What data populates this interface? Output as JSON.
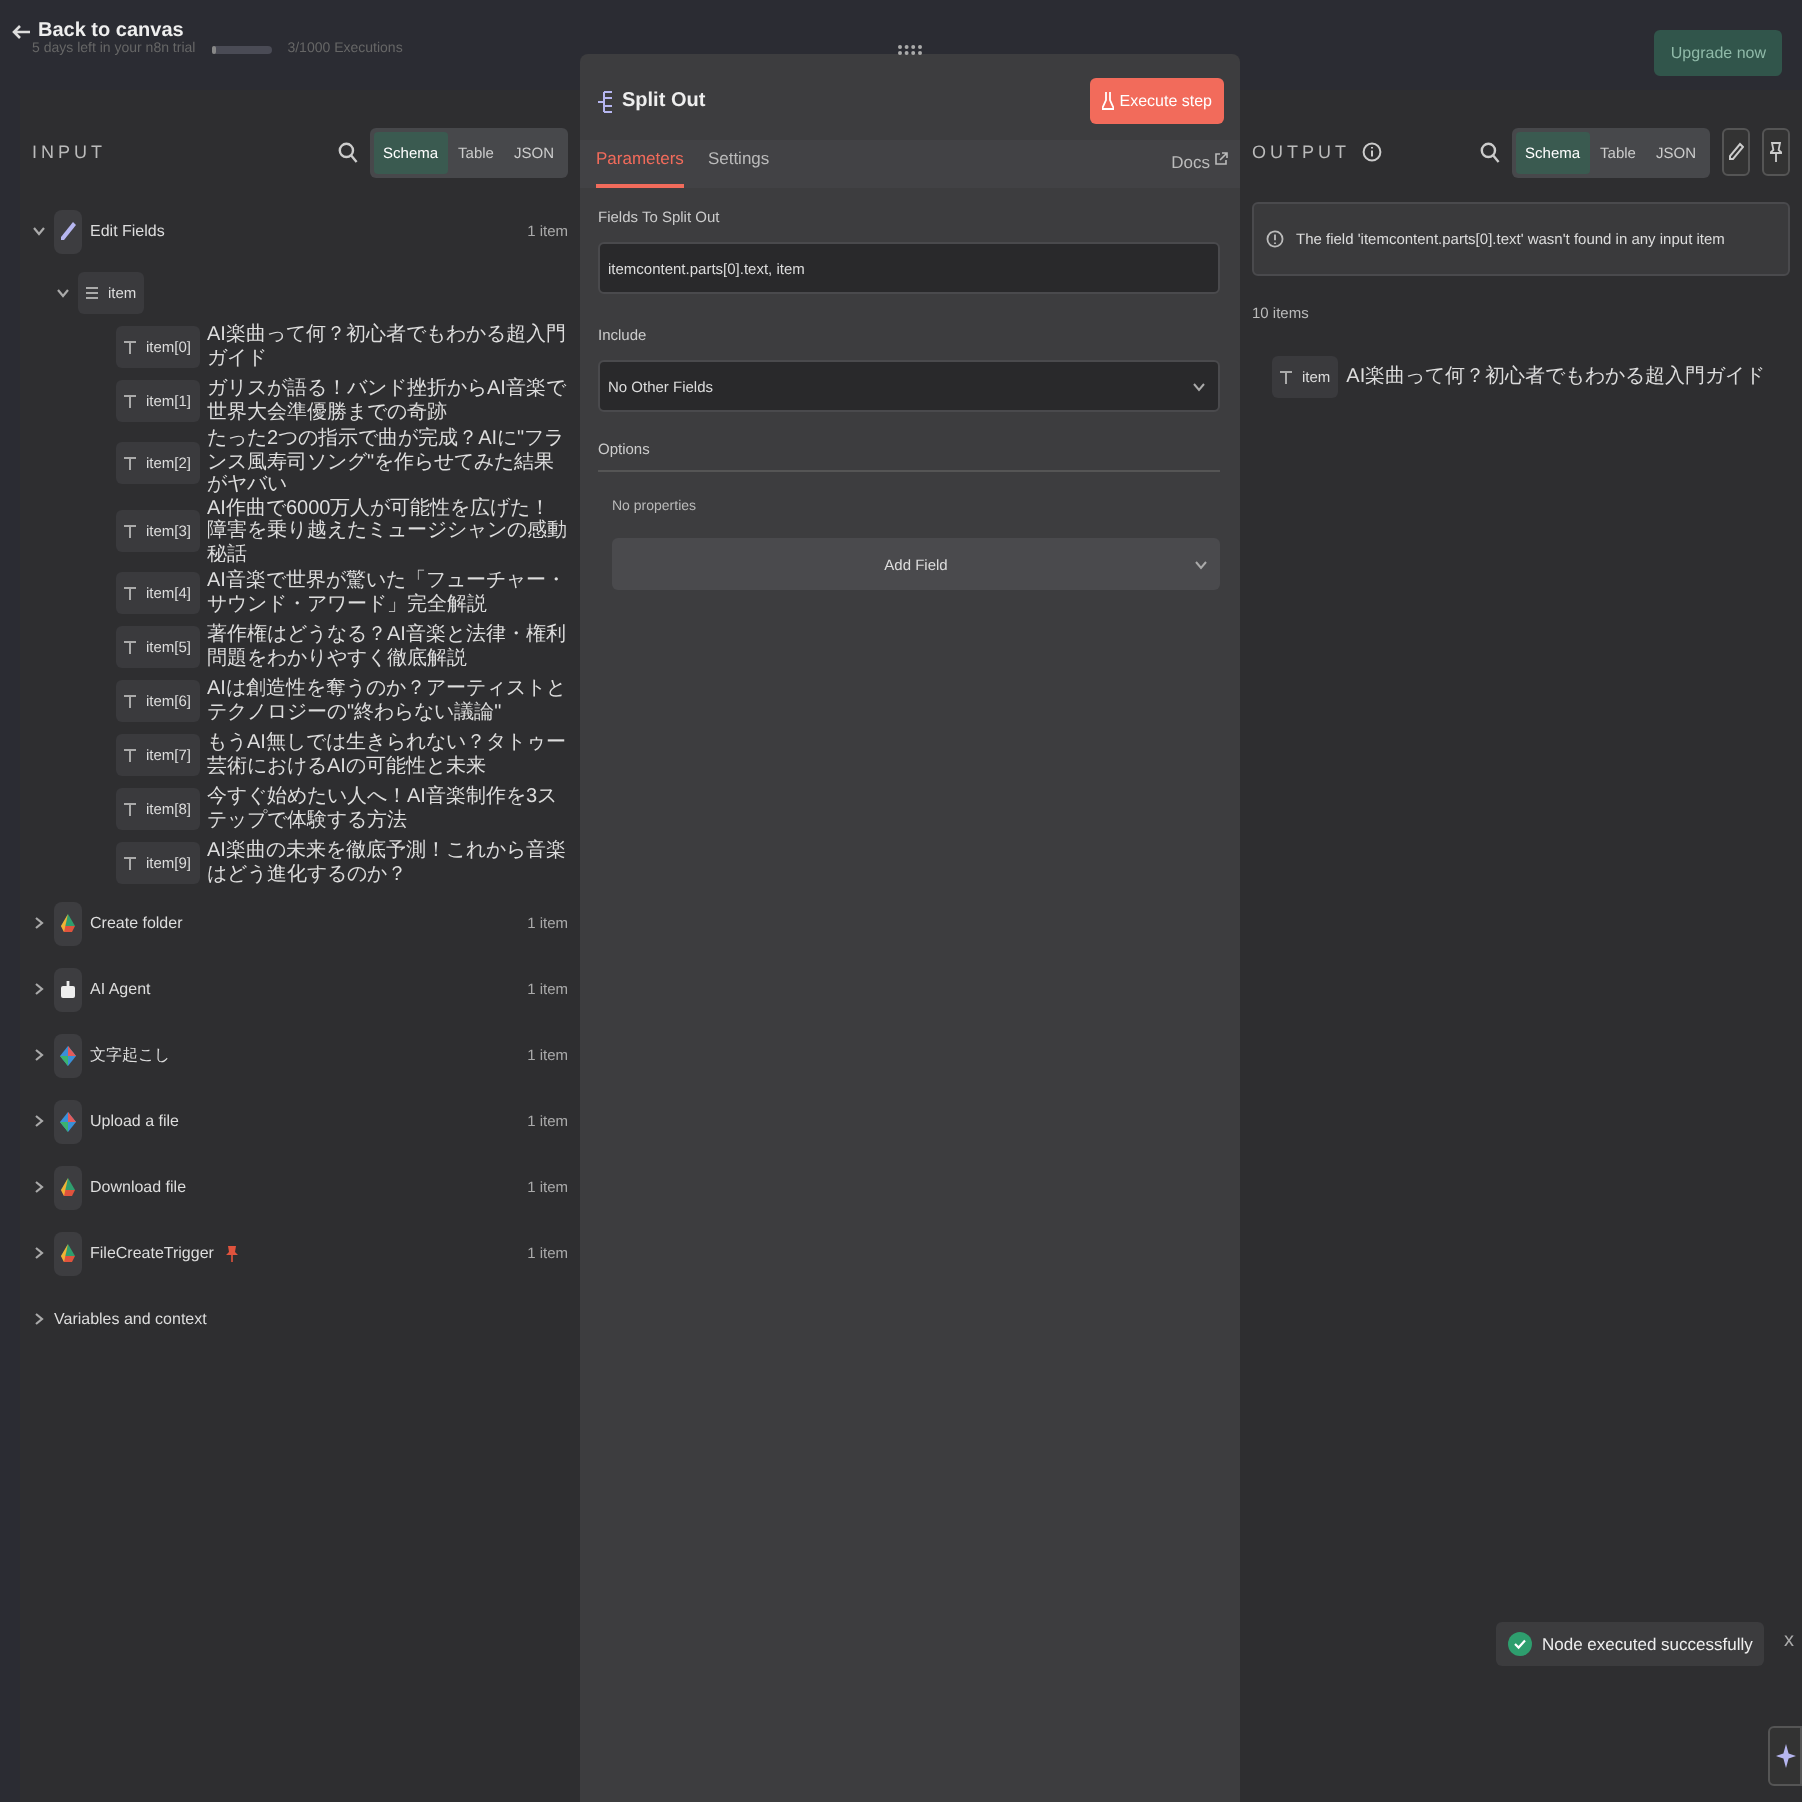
{
  "top_bar": {
    "back_label": "Back to canvas",
    "trial_text": "5 days left in your n8n trial",
    "executions": "3/1000 Executions",
    "upgrade_button": "Upgrade now"
  },
  "input": {
    "title": "INPUT",
    "views": [
      {
        "label": "Schema",
        "selected": true
      },
      {
        "label": "Table",
        "selected": false
      },
      {
        "label": "JSON",
        "selected": false
      }
    ],
    "nodes": [
      {
        "name": "Edit Fields",
        "kind": "pen",
        "count": "1 item",
        "expanded": true,
        "pinned": false,
        "children": [
          {
            "key": "item",
            "kind": "object",
            "expanded": true,
            "children": [
              {
                "key": "item[0]",
                "value": "AI楽曲って何？初心者でもわかる超入門ガイド"
              },
              {
                "key": "item[1]",
                "value": "ガリスが語る！バンド挫折からAI音楽で世界大会準優勝までの奇跡"
              },
              {
                "key": "item[2]",
                "value": "たった2つの指示で曲が完成？AIに\"フランス風寿司ソング\"を作らせてみた結果がヤバい"
              },
              {
                "key": "item[3]",
                "value": "AI作曲で6000万人が可能性を広げた！障害を乗り越えたミュージシャンの感動秘話"
              },
              {
                "key": "item[4]",
                "value": "AI音楽で世界が驚いた「フューチャー・サウンド・アワード」完全解説"
              },
              {
                "key": "item[5]",
                "value": "著作権はどうなる？AI音楽と法律・権利問題をわかりやすく徹底解説"
              },
              {
                "key": "item[6]",
                "value": "AIは創造性を奪うのか？アーティストとテクノロジーの\"終わらない議論\""
              },
              {
                "key": "item[7]",
                "value": "もうAI無しでは生きられない？タトゥー芸術におけるAIの可能性と未来"
              },
              {
                "key": "item[8]",
                "value": "今すぐ始めたい人へ！AI音楽制作を3ステップで体験する方法"
              },
              {
                "key": "item[9]",
                "value": "AI楽曲の未来を徹底予測！これから音楽はどう進化するのか？"
              }
            ]
          }
        ]
      },
      {
        "name": "Create folder",
        "kind": "drive",
        "count": "1 item",
        "expanded": false,
        "pinned": false
      },
      {
        "name": "AI Agent",
        "kind": "robot",
        "count": "1 item",
        "expanded": false,
        "pinned": false
      },
      {
        "name": "文字起こし",
        "kind": "gem",
        "count": "1 item",
        "expanded": false,
        "pinned": false
      },
      {
        "name": "Upload a file",
        "kind": "gem",
        "count": "1 item",
        "expanded": false,
        "pinned": false
      },
      {
        "name": "Download file",
        "kind": "drive",
        "count": "1 item",
        "expanded": false,
        "pinned": false
      },
      {
        "name": "FileCreateTrigger",
        "kind": "drive",
        "count": "1 item",
        "expanded": false,
        "pinned": true
      }
    ],
    "variables_label": "Variables and context"
  },
  "node": {
    "title": "Split Out",
    "execute_button": "Execute step",
    "tabs": [
      {
        "label": "Parameters",
        "selected": true
      },
      {
        "label": "Settings",
        "selected": false
      }
    ],
    "docs_link": "Docs",
    "fields_label": "Fields To Split Out",
    "fields_value": "itemcontent.parts[0].text, item",
    "include_label": "Include",
    "include_value": "No Other Fields",
    "options_label": "Options",
    "no_properties": "No properties",
    "add_field": "Add Field"
  },
  "output": {
    "title": "OUTPUT",
    "views": [
      {
        "label": "Schema",
        "selected": true
      },
      {
        "label": "Table",
        "selected": false
      },
      {
        "label": "JSON",
        "selected": false
      }
    ],
    "notice": "The field 'itemcontent.parts[0].text' wasn't found in any input item",
    "count": "10 items",
    "rows": [
      {
        "key": "item",
        "value": "AI楽曲って何？初心者でもわかる超入門ガイド"
      }
    ]
  },
  "toast": {
    "message": "Node executed successfully",
    "close": "x"
  }
}
